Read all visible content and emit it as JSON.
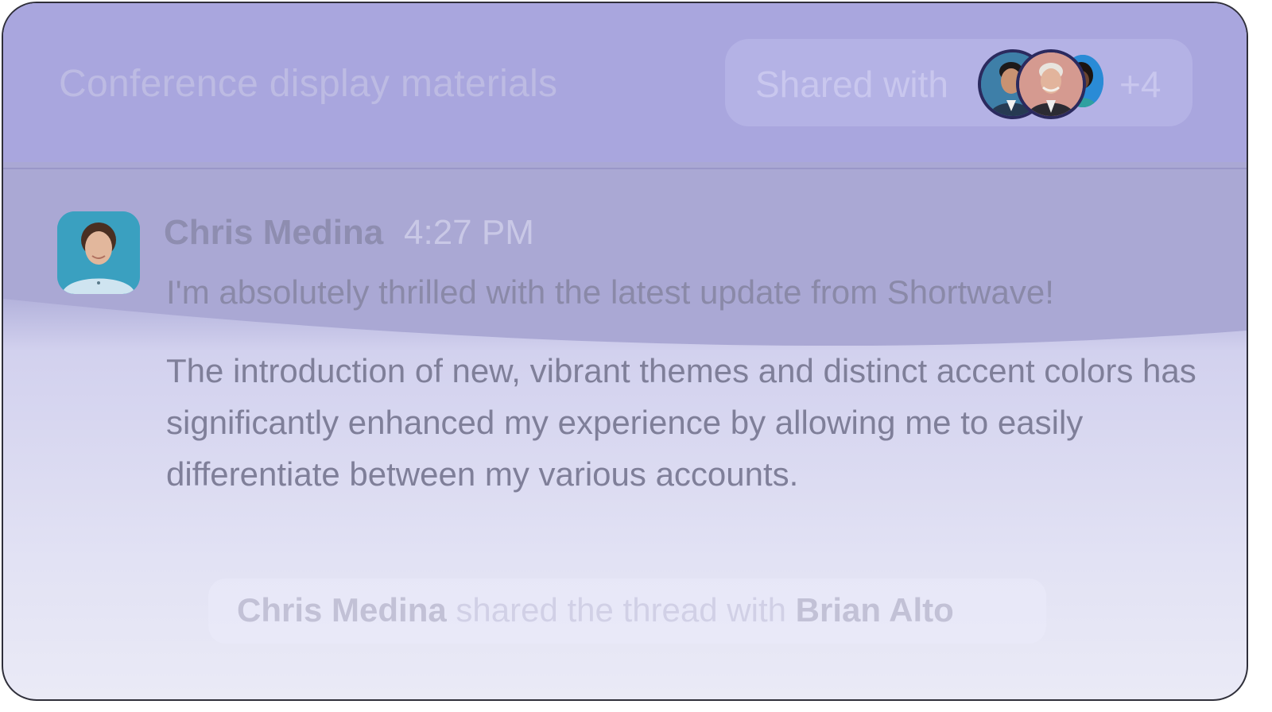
{
  "thread": {
    "title": "Conference display materials",
    "shared_label": "Shared with",
    "shared_more": "+4"
  },
  "message": {
    "author": "Chris Medina",
    "time": "4:27 PM",
    "line1": "I'm absolutely thrilled with the latest update from Shortwave!",
    "body": "The introduction of new, vibrant themes and distinct accent colors has significantly enhanced my experience by allowing me to easily differentiate between my various accounts."
  },
  "event": {
    "actor": "Chris Medina",
    "action": " shared the thread with ",
    "target": "Brian Alto"
  },
  "colors": {
    "header_bg": "#a9a6de",
    "avatar_ring": "#2b2a5e",
    "body_text": "#7f7f99"
  }
}
